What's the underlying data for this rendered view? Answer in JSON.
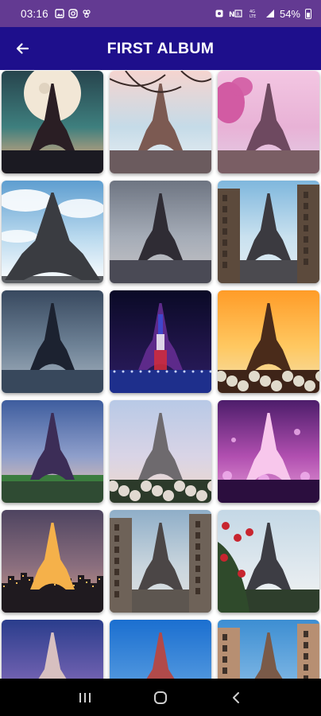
{
  "status_bar": {
    "time": "03:16",
    "battery": "54%",
    "left_icons": [
      "image-icon",
      "instagram-icon",
      "bug-icon"
    ],
    "right_icons": [
      "alarm-icon",
      "nfc-icon",
      "lte-icon",
      "signal-icon",
      "battery-icon"
    ]
  },
  "app_bar": {
    "title": "FIRST ALBUM",
    "back_icon": "arrow-left-icon"
  },
  "grid": {
    "images": [
      {
        "name": "eiffel-tower-full-moon-teal-sky"
      },
      {
        "name": "eiffel-tower-cherry-branches-pastel"
      },
      {
        "name": "eiffel-tower-pink-blossoms-street"
      },
      {
        "name": "eiffel-tower-low-angle-blue-sky"
      },
      {
        "name": "eiffel-tower-grey-dusk-river"
      },
      {
        "name": "eiffel-tower-parisian-street"
      },
      {
        "name": "eiffel-tower-night-bridge-blue"
      },
      {
        "name": "eiffel-tower-tricolor-lights-night"
      },
      {
        "name": "eiffel-tower-golden-sunset-flowers"
      },
      {
        "name": "eiffel-tower-trocadero-dusk"
      },
      {
        "name": "eiffel-tower-white-blossom-garden"
      },
      {
        "name": "eiffel-tower-purple-bokeh"
      },
      {
        "name": "eiffel-tower-lit-city-dusk"
      },
      {
        "name": "eiffel-tower-cobblestone-street"
      },
      {
        "name": "eiffel-tower-red-roses"
      },
      {
        "name": "eiffel-tower-night-city-purple"
      },
      {
        "name": "eiffel-tower-blue-sky-clouds"
      },
      {
        "name": "eiffel-tower-between-buildings"
      }
    ]
  },
  "nav_bar": {
    "buttons": [
      "recent-apps-icon",
      "home-icon",
      "back-icon"
    ]
  },
  "colors": {
    "status_bar": "#633a92",
    "app_bar": "#1e0f8c",
    "nav_bar": "#000000"
  }
}
